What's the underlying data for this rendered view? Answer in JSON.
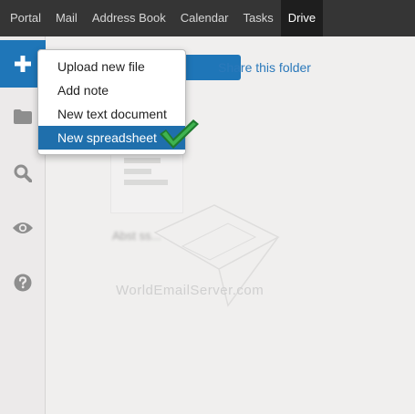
{
  "topnav": {
    "tabs": [
      {
        "label": "Portal"
      },
      {
        "label": "Mail"
      },
      {
        "label": "Address Book"
      },
      {
        "label": "Calendar"
      },
      {
        "label": "Tasks"
      },
      {
        "label": "Drive"
      }
    ],
    "active_tab": "Drive"
  },
  "sidebar": {
    "buttons": [
      "plus-icon",
      "folder-icon",
      "search-icon",
      "eye-icon",
      "help-icon"
    ]
  },
  "toolbar": {
    "share_label": "Share this folder"
  },
  "new_menu": {
    "items": [
      {
        "label": "Upload new file"
      },
      {
        "label": "Add note"
      },
      {
        "label": "New text document"
      },
      {
        "label": "New spreadsheet"
      }
    ],
    "selected_item": "New spreadsheet"
  },
  "files": [
    {
      "name": "Abst ss..."
    }
  ],
  "watermark": {
    "text": "WorldEmailServer.com"
  },
  "colors": {
    "nav_bg": "#353535",
    "nav_active_bg": "#1e1e1e",
    "accent": "#1f76b8",
    "link": "#2b79bb",
    "checkmark": "#2e9e3e"
  }
}
